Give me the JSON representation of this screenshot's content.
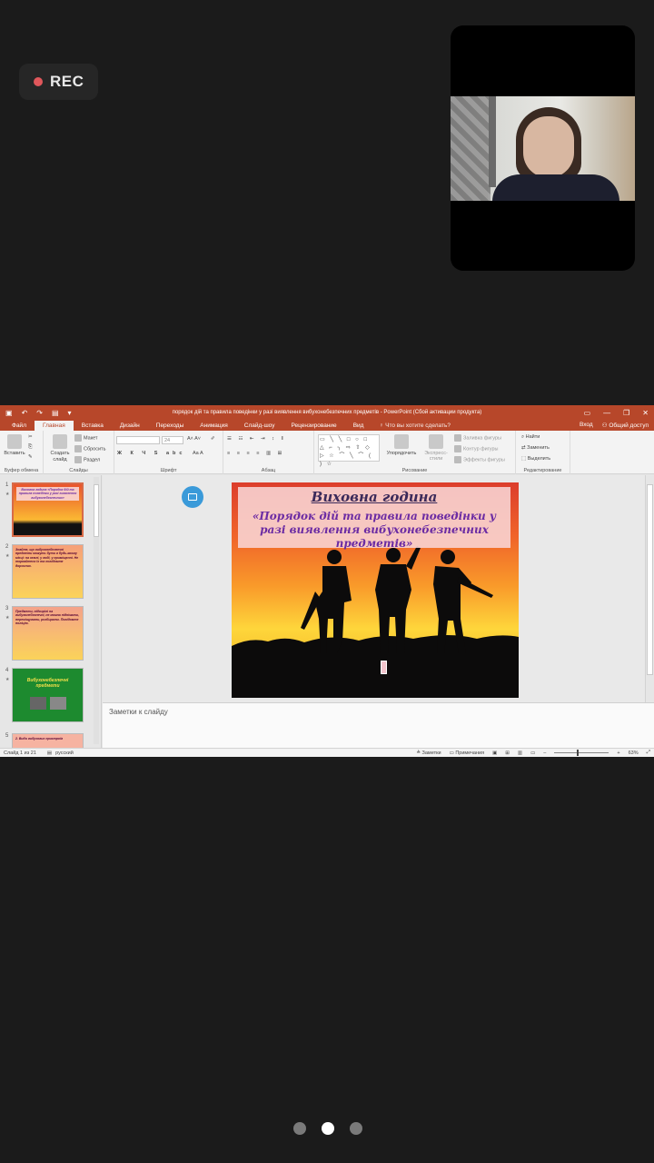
{
  "recording": {
    "label": "REC"
  },
  "window": {
    "title": "порядок дій та правила поведінки у разі виявлення вибухонебезпечних предметів - PowerPoint (Сбой активации продукта)",
    "accent": "#b7472a"
  },
  "menu": {
    "tabs": [
      "Файл",
      "Главная",
      "Вставка",
      "Дизайн",
      "Переходы",
      "Анимация",
      "Слайд-шоу",
      "Рецензирование",
      "Вид"
    ],
    "active_tab": "Главная",
    "tell_me": "Что вы хотите сделать?",
    "sign_in": "Вход",
    "share": "Общий доступ"
  },
  "ribbon": {
    "paste": "Вставить",
    "clipboard_group": "Буфер обмена",
    "new_slide": "Создать слайд",
    "layout": "Макет",
    "reset": "Сбросить",
    "section": "Раздел",
    "slides_group": "Слайды",
    "font_size": "24",
    "font_group": "Шрифт",
    "paragraph_group": "Абзац",
    "arrange": "Упорядочить",
    "quick_styles": "Экспресс-стили",
    "shape_fill": "Заливка фигуры",
    "shape_outline": "Контур фигуры",
    "shape_effects": "Эффекты фигуры",
    "drawing_group": "Рисование",
    "find": "Найти",
    "replace": "Заменить",
    "select": "Выделить",
    "editing_group": "Редактирование"
  },
  "thumbnails": [
    {
      "num": "1",
      "text": "Виховна година «Порядок дій та правила поведінки у разі виявлення вибухонебезпечних»"
    },
    {
      "num": "2",
      "text": "Знайте, що вибухонебезпечні предмети можуть бути в будь-якому місці: на землі, у воді, у приміщенні. Не торкайтеся їх та повідомте дорослих."
    },
    {
      "num": "3",
      "text": "Предмети, підозрілі на вибухонебезпечні, не можна піднімати, переміщувати, розбирати. Повідомте поліцію."
    },
    {
      "num": "4",
      "text": "Вибухонебезпечні предмети"
    },
    {
      "num": "5",
      "text": "2. Види вибухових пристроїв"
    }
  ],
  "slide": {
    "title": "Виховна година",
    "subtitle": "«Порядок дій та правила поведінки у разі виявлення вибухонебезпечних предметів»"
  },
  "notes": {
    "placeholder": "Заметки к слайду"
  },
  "status": {
    "slide_counter": "Слайд 1 из 21",
    "language": "русский",
    "notes": "Заметки",
    "comments": "Примечания",
    "zoom": "63%"
  }
}
